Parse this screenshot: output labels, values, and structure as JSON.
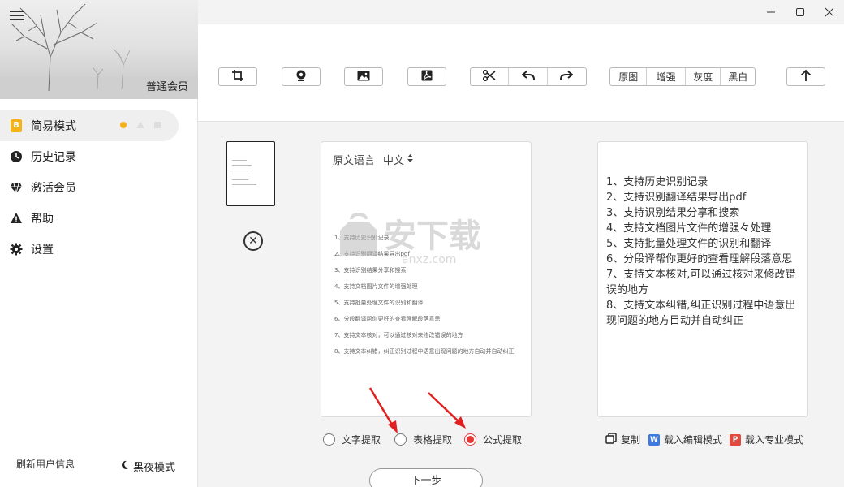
{
  "sidebar": {
    "member_label": "普通会员",
    "nav": [
      {
        "label": "简易模式",
        "icon": "b-badge-icon"
      },
      {
        "label": "历史记录",
        "icon": "clock-icon"
      },
      {
        "label": "激活会员",
        "icon": "diamond-icon"
      },
      {
        "label": "帮助",
        "icon": "warning-icon"
      },
      {
        "label": "设置",
        "icon": "gear-icon"
      }
    ],
    "badge_letter": "B",
    "refresh_label": "刷新用户信息",
    "night_label": "黑夜模式"
  },
  "toolbar": {
    "filters": [
      "原图",
      "增强",
      "灰度",
      "黑白"
    ]
  },
  "source_panel": {
    "lang_label": "原文语言",
    "lang_value": "中文",
    "lines": [
      "1、支持历史识别记录",
      "2、支持识别翻译结果导出pdf",
      "3、支持识别结果分享和搜索",
      "4、支持文档图片文件的增强处理",
      "5、支持批量处理文件的识别和翻译",
      "6、分段翻译帮你更好的查看理解段落意思",
      "7、支持文本核对，可以通过核对来修改错误的地方",
      "8、支持文本纠错，纠正识别过程中语意出现问题的地方自动并自动纠正"
    ]
  },
  "result_panel": {
    "lines": [
      "1、支持历史识别记录",
      "2、支持识别翻译结果导出pdf",
      "3、支持识别结果分享和搜索",
      "4、支持文档图片文件的增强々处理",
      "5、支持批量处理文件的识别和翻译",
      "6、分段译帮你更好的查看理解段落意思",
      "7、支持文本核对,可以通过核对来修改错误的地方",
      "8、支持文本纠错,纠正识别过程中语意出现问题的地方目动并自动纠正"
    ]
  },
  "extract_options": [
    {
      "label": "文字提取",
      "selected": false
    },
    {
      "label": "表格提取",
      "selected": false
    },
    {
      "label": "公式提取",
      "selected": true
    }
  ],
  "actions": {
    "copy": "复制",
    "word": "载入编辑模式",
    "word_letter": "W",
    "pro": "载入专业模式",
    "pro_letter": "P"
  },
  "next_label": "下一步",
  "watermark": {
    "text": "安下载",
    "sub": "anxz.com"
  },
  "colors": {
    "accent": "#f3b21a",
    "radio_on": "#e53935",
    "word": "#3d7be3",
    "pdf": "#e2493d"
  }
}
